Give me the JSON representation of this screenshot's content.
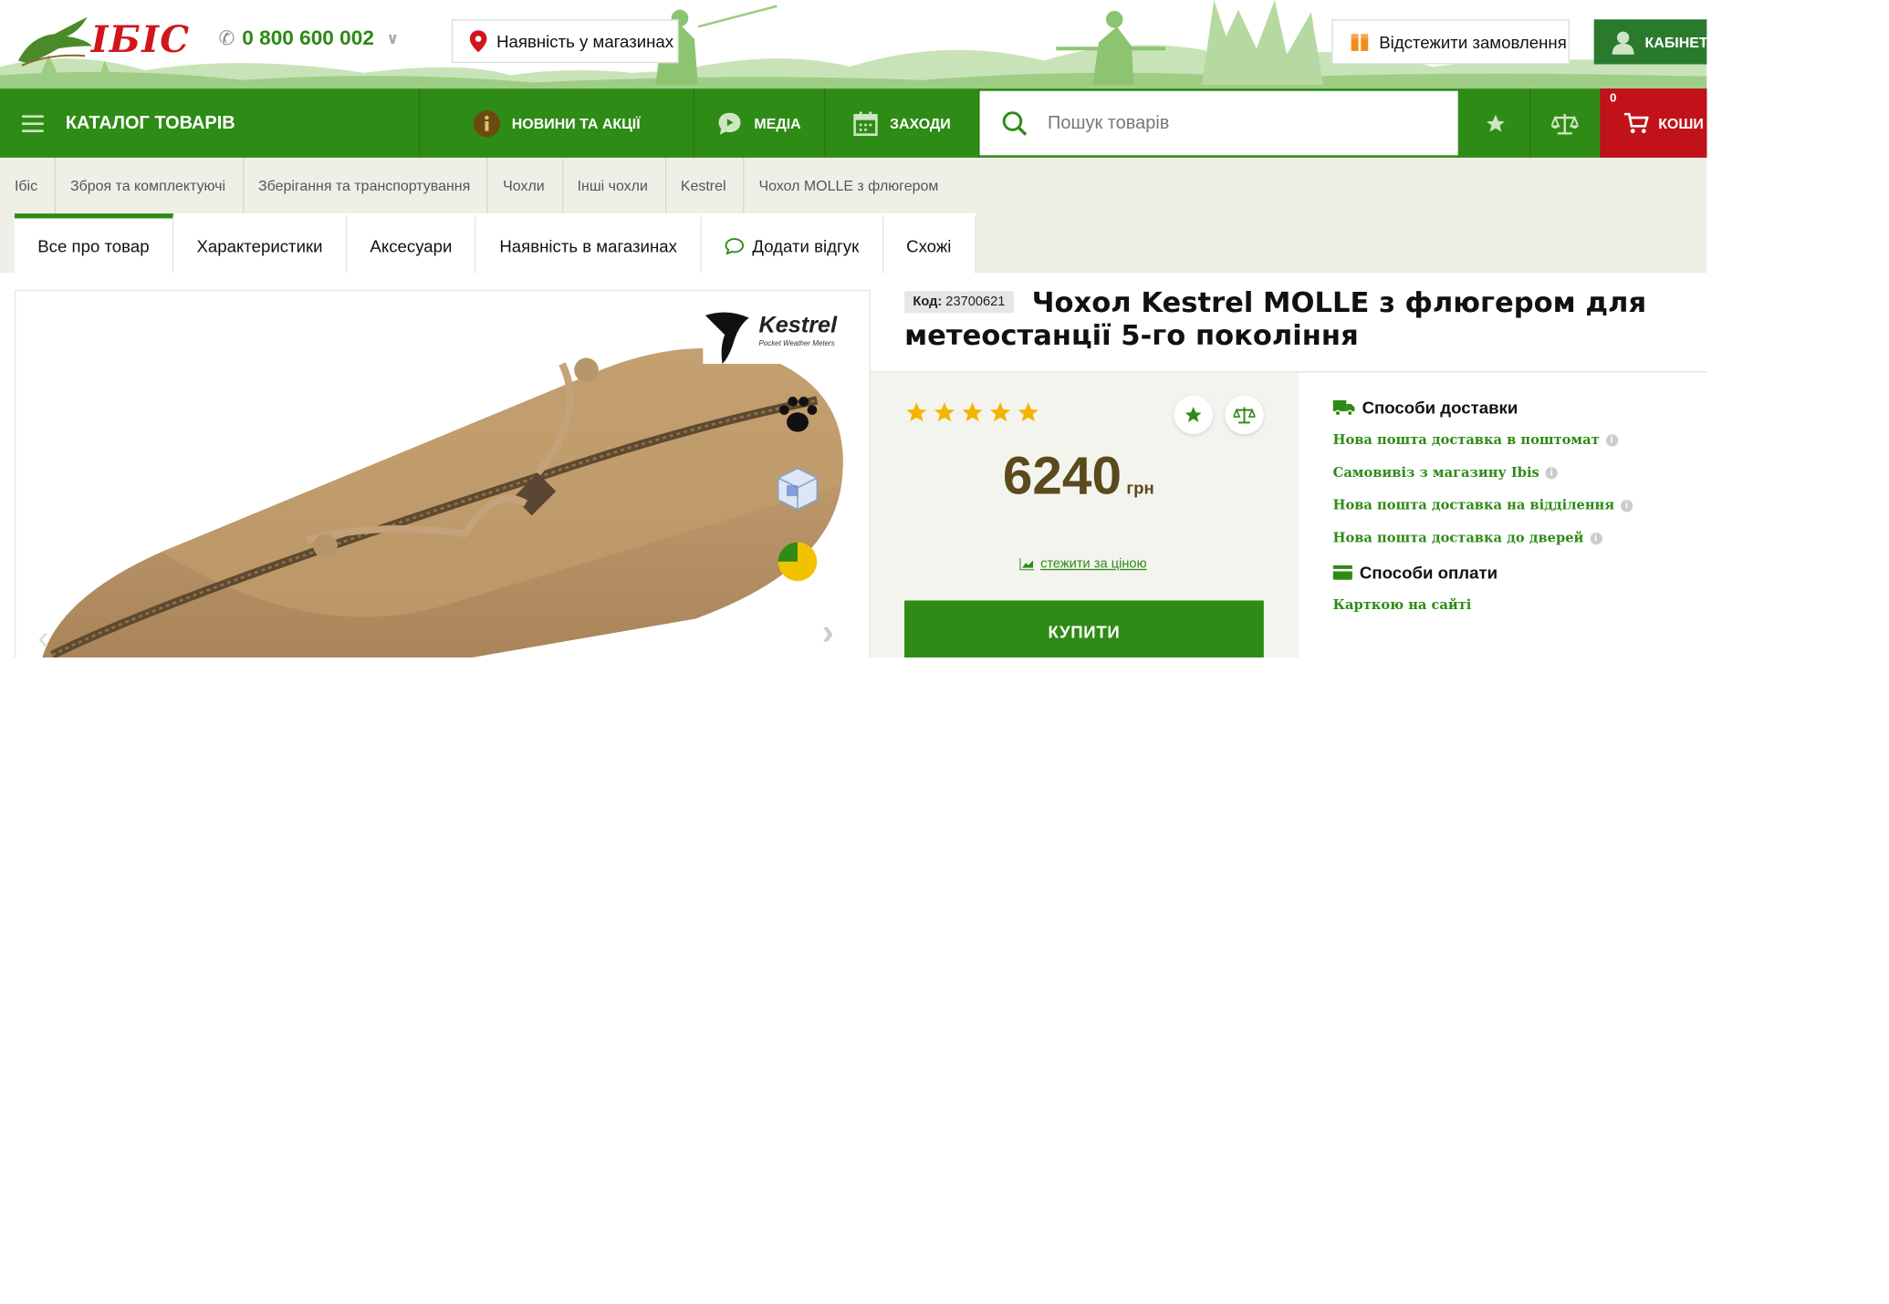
{
  "header": {
    "logo_text": "IБIC",
    "phone": "0 800 600 002",
    "stores_label": "Наявність у магазинах",
    "track_label": "Відстежити замовлення",
    "cabinet_label": "КАБІНЕТ"
  },
  "nav": {
    "catalog": "КАТАЛОГ ТОВАРІВ",
    "news": "НОВИНИ ТА АКЦІЇ",
    "media": "МЕДІА",
    "events": "ЗАХОДИ",
    "search_placeholder": "Пошук товарів",
    "cart_label": "КОШИ",
    "cart_count": "0"
  },
  "breadcrumbs": [
    "Ібіс",
    "Зброя та комплектуючі",
    "Зберігання та транспортування",
    "Чохли",
    "Інші чохли",
    "Kestrel",
    "Чохол MOLLE з флюгером"
  ],
  "tabs": [
    "Все про товар",
    "Характеристики",
    "Аксесуари",
    "Наявність в магазинах",
    "Додати відгук",
    "Схожі"
  ],
  "product": {
    "code_label": "Код:",
    "code": "23700621",
    "title": "Чохол Kestrel MOLLE з флюгером для метеостанції 5-го покоління",
    "brand_name": "Kestrel",
    "brand_tagline": "Pocket Weather Meters",
    "rating": 5,
    "price": "6240",
    "currency": "грн",
    "watch_price": "стежити за ціною",
    "buy_label": "КУПИТИ"
  },
  "delivery": {
    "title": "Способи доставки",
    "options": [
      "Нова пошта доставка в поштомат",
      "Самовивіз з магазину Ibis",
      "Нова пошта доставка на відділення",
      "Нова пошта доставка до дверей"
    ]
  },
  "payment": {
    "title": "Способи оплати",
    "options": [
      "Карткою на сайті"
    ]
  },
  "colors": {
    "green": "#2e8b16",
    "red": "#c1121a",
    "star": "#f5b400"
  }
}
